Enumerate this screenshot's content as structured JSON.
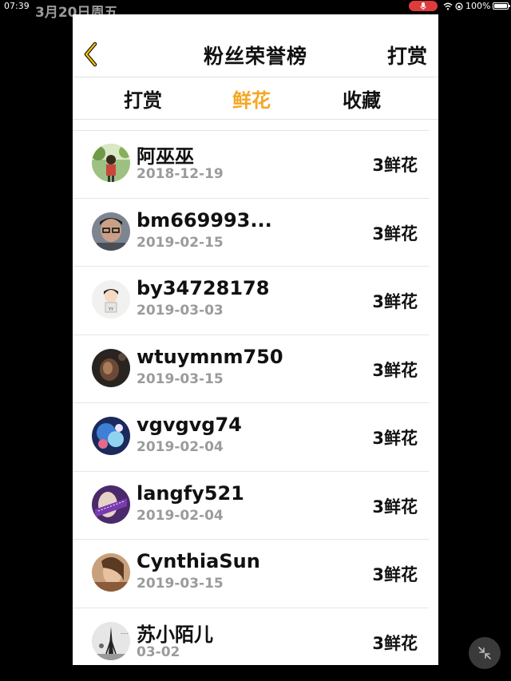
{
  "status_bar": {
    "time": "07:39",
    "date": "3月20日周五",
    "battery": "100%"
  },
  "header": {
    "title": "粉丝荣誉榜",
    "action_label": "打赏"
  },
  "tabs": [
    {
      "label": "打赏",
      "active": false
    },
    {
      "label": "鲜花",
      "active": true
    },
    {
      "label": "收藏",
      "active": false
    }
  ],
  "fans": [
    {
      "name": "阿巫巫",
      "date": "2018-12-19",
      "amount": "3鲜花",
      "avatar": "avatar-boy-outdoor"
    },
    {
      "name": "bm669993...",
      "date": "2019-02-15",
      "amount": "3鲜花",
      "avatar": "avatar-man-glasses"
    },
    {
      "name": "by34728178",
      "date": "2019-03-03",
      "amount": "3鲜花",
      "avatar": "avatar-cartoon-boy"
    },
    {
      "name": "wtuymnm750",
      "date": "2019-03-15",
      "amount": "3鲜花",
      "avatar": "avatar-dark-portrait"
    },
    {
      "name": "vgvgvg74",
      "date": "2019-02-04",
      "amount": "3鲜花",
      "avatar": "avatar-blue-fantasy"
    },
    {
      "name": "langfy521",
      "date": "2019-02-04",
      "amount": "3鲜花",
      "avatar": "avatar-purple-girl"
    },
    {
      "name": "CynthiaSun",
      "date": "2019-03-15",
      "amount": "3鲜花",
      "avatar": "avatar-warm-portrait"
    },
    {
      "name": "苏小陌儿",
      "date": "03-02",
      "amount": "3鲜花",
      "avatar": "avatar-eiffel-bw"
    }
  ],
  "colors": {
    "accent": "#f5a623",
    "text": "#111111",
    "secondary_text": "#9b9b9b",
    "mic_indicator": "#e03b3b"
  }
}
